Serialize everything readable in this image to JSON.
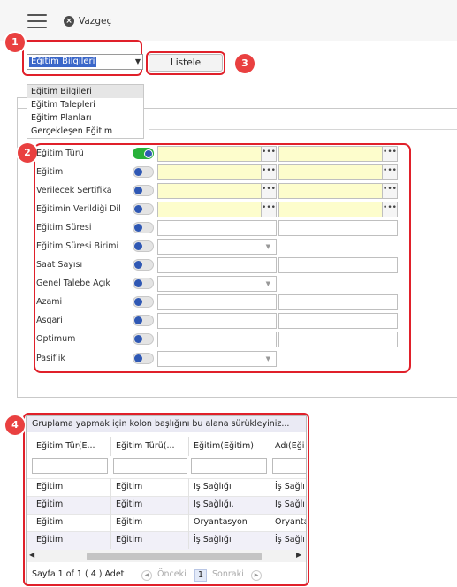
{
  "toolbar": {
    "cancel_label": "Vazgeç"
  },
  "badges": {
    "b1": "1",
    "b2": "2",
    "b3": "3",
    "b4": "4"
  },
  "selector": {
    "selected": "Eğitim Bilgileri",
    "options": [
      "Eğitim Bilgileri",
      "Eğitim Talepleri",
      "Eğitim Planları",
      "Gerçekleşen Eğitim"
    ],
    "list_button": "Listele"
  },
  "form": {
    "fields": [
      "Eğitim Türü",
      "Eğitim",
      "Verilecek Sertifika",
      "Eğitimin Verildiği Dil",
      "Eğitim Süresi",
      "Eğitim Süresi Birimi",
      "Saat Sayısı",
      "Genel Talebe Açık",
      "Azami",
      "Asgari",
      "Optimum",
      "Pasiflik"
    ],
    "lookup_glyph": "•••"
  },
  "grid": {
    "group_hint": "Gruplama yapmak için kolon başlığını bu alana sürükleyiniz...",
    "columns": [
      "Eğitim Tür(E...",
      "Eğitim Türü(...",
      "Eğitim(Eğitim)",
      "Adı(Eği"
    ],
    "rows": [
      [
        "Eğitim",
        "Eğitim",
        "Iş Sağlığı",
        "İş Sağlı"
      ],
      [
        "Eğitim",
        "Eğitim",
        "İş Sağlığı.",
        "İş Sağlı"
      ],
      [
        "Eğitim",
        "Eğitim",
        "Oryantasyon",
        "Oryanta"
      ],
      [
        "Eğitim",
        "Eğitim",
        "İş Sağlığı",
        "İş Sağlı"
      ]
    ],
    "pager": {
      "text": "Sayfa 1 of 1 ( 4 ) Adet",
      "prev": "Önceki",
      "page": "1",
      "next": "Sonraki"
    }
  }
}
